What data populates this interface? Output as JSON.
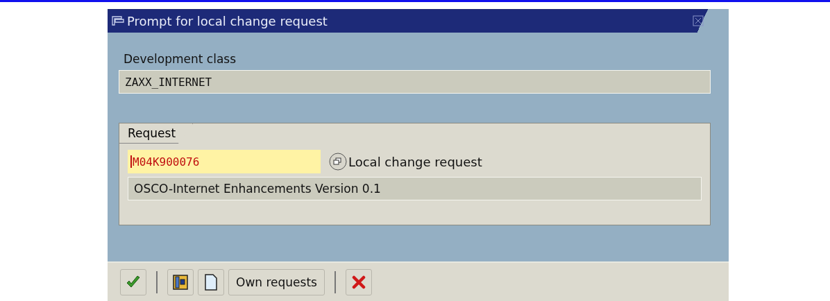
{
  "window": {
    "title": "Prompt for local change request"
  },
  "development_class": {
    "label": "Development class",
    "value": "ZAXX_INTERNET"
  },
  "request": {
    "tab": "Request",
    "value": "M04K900076",
    "match_label": "Local change request",
    "description": "OSCO-Internet Enhancements Version 0.1"
  },
  "toolbar": [
    {
      "kind": "check"
    },
    {
      "kind": "separator"
    },
    {
      "kind": "hierarchy"
    },
    {
      "kind": "new"
    },
    {
      "kind": "text",
      "label": "Own requests"
    },
    {
      "kind": "separator"
    },
    {
      "kind": "cancel"
    }
  ]
}
